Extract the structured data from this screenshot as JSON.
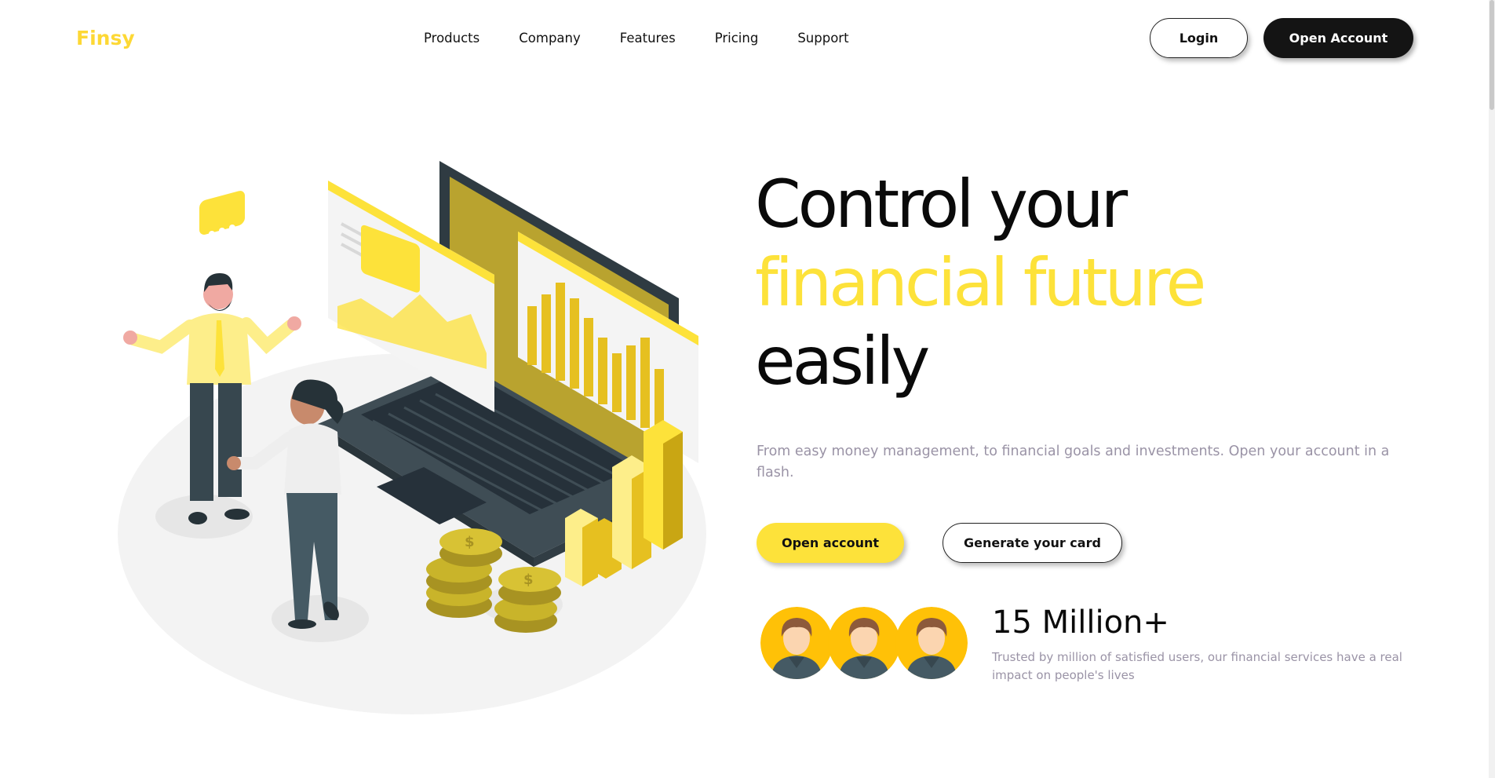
{
  "nav": {
    "logo": "Finsy",
    "links": [
      "Products",
      "Company",
      "Features",
      "Pricing",
      "Support"
    ],
    "login_label": "Login",
    "open_account_label": "Open Account"
  },
  "hero": {
    "title_line1": "Control your",
    "title_line2": "financial future",
    "title_line3": "easily",
    "description": "From easy money management, to financial goals and investments. Open your account in a flash.",
    "cta_primary": "Open account",
    "cta_secondary": "Generate your card"
  },
  "stats": {
    "count": "15 Million+",
    "description": "Trusted by million of satisfied users, our financial services have a real impact on people's lives"
  },
  "colors": {
    "accent": "#FDE23A",
    "dark": "#141414",
    "muted_text": "#9a93a6"
  },
  "icons": [
    "user-avatar-icon",
    "upload-arrow-icon",
    "chat-bubble-icon",
    "dollar-coin-icon"
  ]
}
